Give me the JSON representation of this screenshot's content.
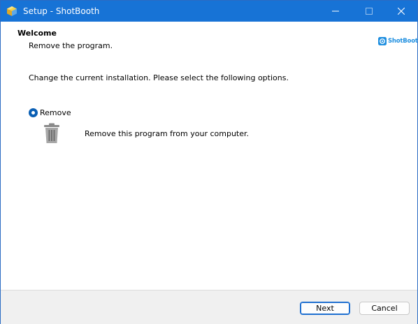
{
  "window": {
    "title": "Setup - ShotBooth",
    "accent_color": "#1773d6",
    "app_icon": "package-icon",
    "controls": [
      "minimize-icon",
      "maximize-icon",
      "close-icon"
    ]
  },
  "header": {
    "title": "Welcome",
    "subtitle": "Remove the program.",
    "brand_logo_text": "ShotBooth",
    "brand_logo_icon": "shotbooth-logo-icon"
  },
  "content": {
    "instructions": "Change the current installation. Please select the following options.",
    "options": [
      {
        "label": "Remove",
        "selected": true,
        "icon": "trash-icon",
        "description": "Remove this program from your computer."
      }
    ]
  },
  "footer": {
    "next_label": "Next",
    "cancel_label": "Cancel"
  }
}
